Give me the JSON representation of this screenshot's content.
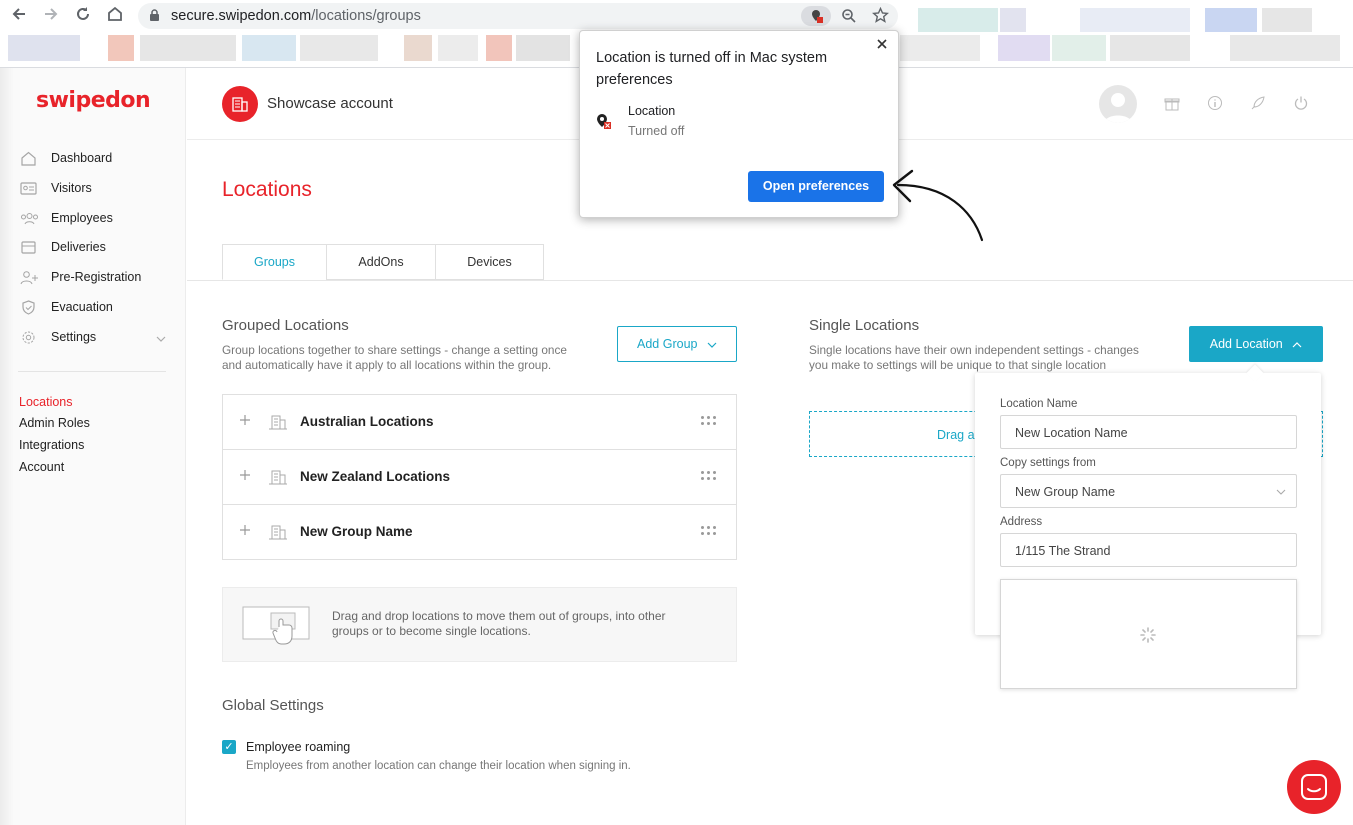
{
  "browser": {
    "url_host": "secure.swipedon.com",
    "url_path": "/locations/groups"
  },
  "sidebar": {
    "logo": "swipedon",
    "items": [
      {
        "label": "Dashboard",
        "icon": "home-icon"
      },
      {
        "label": "Visitors",
        "icon": "id-card-icon"
      },
      {
        "label": "Employees",
        "icon": "people-icon"
      },
      {
        "label": "Deliveries",
        "icon": "package-icon"
      },
      {
        "label": "Pre-Registration",
        "icon": "person-add-icon"
      },
      {
        "label": "Evacuation",
        "icon": "shield-icon"
      },
      {
        "label": "Settings",
        "icon": "gear-icon"
      }
    ],
    "sub_items": [
      "Locations",
      "Admin Roles",
      "Integrations",
      "Account"
    ]
  },
  "header": {
    "account_name": "Showcase account"
  },
  "page": {
    "title": "Locations",
    "tabs": [
      "Groups",
      "AddOns",
      "Devices"
    ]
  },
  "grouped": {
    "title": "Grouped Locations",
    "desc_line1": "Group locations together to share settings - change a setting once",
    "desc_line2": "and automatically have it apply to all locations within the group.",
    "add_button": "Add Group",
    "groups": [
      "Australian Locations",
      "New Zealand Locations",
      "New Group Name"
    ],
    "dnd_line1": "Drag and drop locations to move them out of groups, into other",
    "dnd_line2": "groups or to become single locations."
  },
  "global": {
    "title": "Global Settings",
    "roaming_label": "Employee roaming",
    "roaming_desc": "Employees from another location can change their location when signing in."
  },
  "single": {
    "title": "Single Locations",
    "desc_line1": "Single locations have their own independent settings - changes",
    "desc_line2": "you make to settings will be unique to that single location",
    "add_button": "Add Location",
    "drop_text": "Drag a"
  },
  "add_location_form": {
    "name_label": "Location Name",
    "name_value": "New Location Name",
    "copy_label": "Copy settings from",
    "copy_value": "New Group Name",
    "address_label": "Address",
    "address_value": "1/115 The Strand"
  },
  "location_popup": {
    "title": "Location is turned off in Mac system preferences",
    "item_title": "Location",
    "item_status": "Turned off",
    "button": "Open preferences"
  },
  "colors": {
    "brand": "#e8232a",
    "accent": "#1aa7c7",
    "chrome_button": "#1a73e8"
  }
}
